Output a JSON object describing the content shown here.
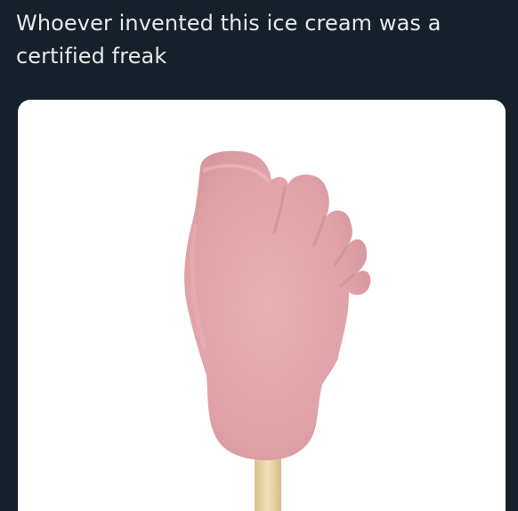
{
  "tweet": {
    "text_line1": "Whoever invented this ice cream was a",
    "text_line2": "certified freak"
  },
  "media": {
    "icon": "foot-shaped-ice-cream-bar-photo",
    "colors": {
      "background": "#15202b",
      "card": "#ffffff",
      "ice_cream": "#e6a3a8",
      "stick": "#e8d6a6"
    }
  }
}
